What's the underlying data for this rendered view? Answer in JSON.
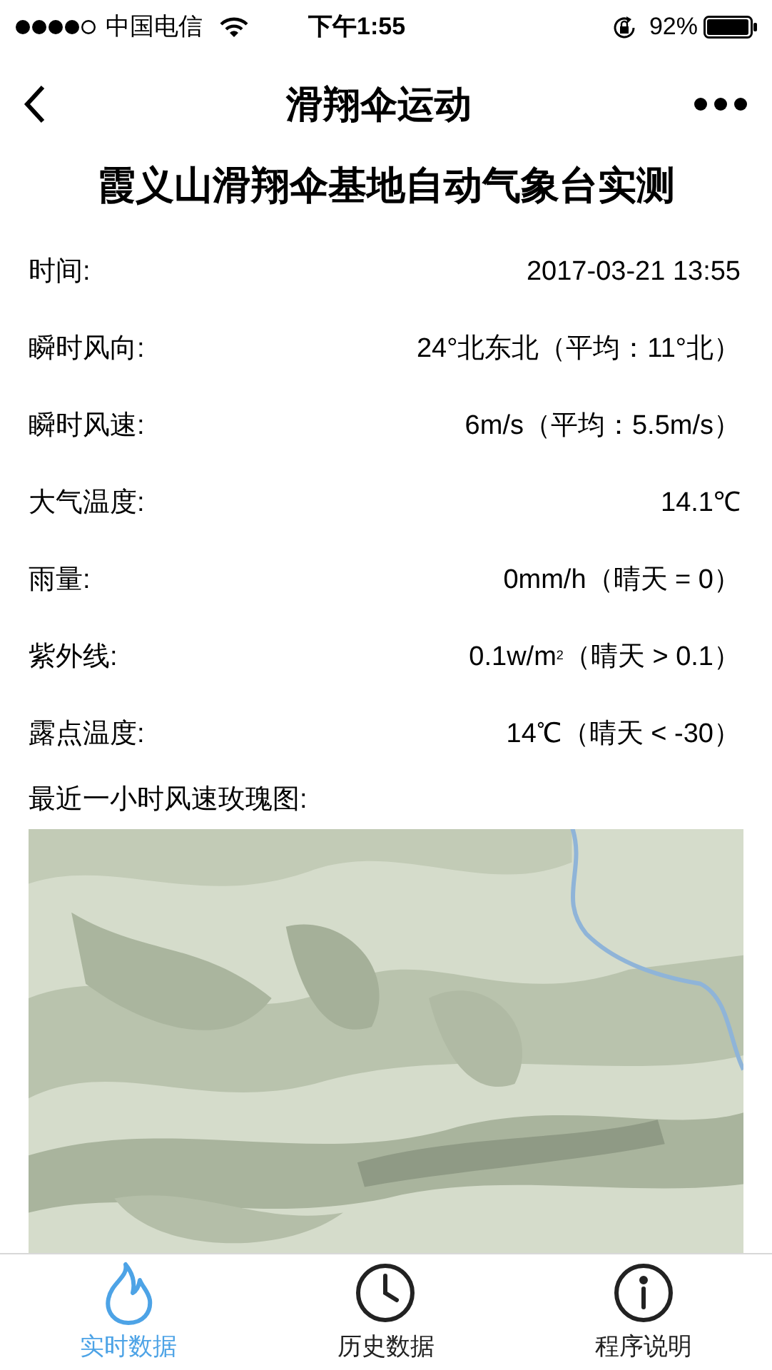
{
  "status_bar": {
    "carrier": "中国电信",
    "time": "下午1:55",
    "battery": "92%"
  },
  "nav": {
    "title": "滑翔伞运动"
  },
  "heading": "霞义山滑翔伞基地自动气象台实测",
  "rows": [
    {
      "label": "时间:",
      "value": "2017-03-21 13:55"
    },
    {
      "label": "瞬时风向:",
      "value": "24°北东北（平均：11°北）"
    },
    {
      "label": "瞬时风速:",
      "value": "6m/s（平均：5.5m/s）"
    },
    {
      "label": "大气温度:",
      "value": "14.1℃"
    },
    {
      "label": "雨量:",
      "value": "0mm/h（晴天 = 0）"
    },
    {
      "label": "紫外线:",
      "value": "0.1w/m$^{2}$（晴天 > 0.1）"
    },
    {
      "label": "露点温度:",
      "value": "14℃（晴天 < -30）"
    }
  ],
  "map_caption": "最近一小时风速玫瑰图:",
  "tabs": [
    {
      "label": "实时数据",
      "kind": "flame",
      "selected": true
    },
    {
      "label": "历史数据",
      "kind": "clock",
      "selected": false
    },
    {
      "label": "程序说明",
      "kind": "info",
      "selected": false
    }
  ]
}
